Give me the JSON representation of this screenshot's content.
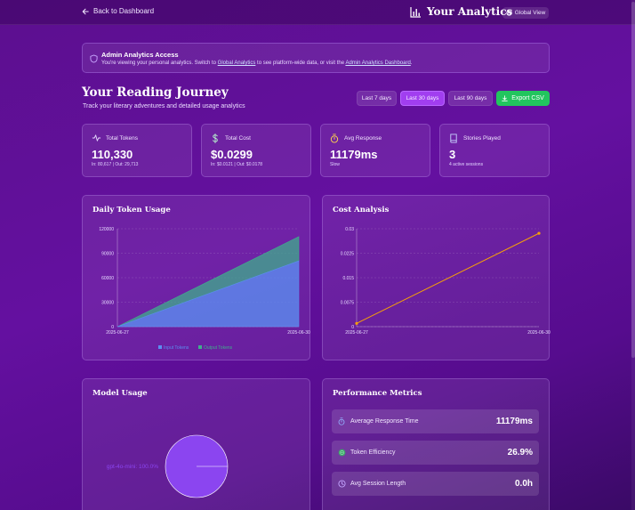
{
  "header": {
    "back_label": "Back to Dashboard",
    "title": "Your Analytics",
    "global_view_label": "Global View"
  },
  "notice": {
    "title": "Admin Analytics Access",
    "text_before": "You're viewing your personal analytics. Switch to ",
    "link1": "Global Analytics",
    "text_middle": " to see platform-wide data, or visit the ",
    "link2": "Admin Analytics Dashboard",
    "text_after": "."
  },
  "page": {
    "title": "Your Reading Journey",
    "subtitle": "Track your literary adventures and detailed usage analytics"
  },
  "ranges": [
    {
      "label": "Last 7 days",
      "active": false
    },
    {
      "label": "Last 30 days",
      "active": true
    },
    {
      "label": "Last 90 days",
      "active": false
    }
  ],
  "export_label": "Export CSV",
  "stats": [
    {
      "icon": "activity-icon",
      "label": "Total Tokens",
      "value": "110,330",
      "sub": "In: 80,617 | Out: 29,713"
    },
    {
      "icon": "dollar-icon",
      "label": "Total Cost",
      "value": "$0.0299",
      "sub": "In: $0.0121 | Out: $0.0178"
    },
    {
      "icon": "timer-icon",
      "label": "Avg Response",
      "value": "11179ms",
      "sub": "Slow"
    },
    {
      "icon": "book-icon",
      "label": "Stories Played",
      "value": "3",
      "sub": "4 active sessions"
    }
  ],
  "colors": {
    "input_tokens": "#5b8df0",
    "output_tokens": "#3fae8c",
    "cost_line": "#f59e0b",
    "pie": "#8b45f0",
    "accent": "#a13ef0",
    "export": "#22c55e"
  },
  "token_panel": {
    "title": "Daily Token Usage"
  },
  "cost_panel": {
    "title": "Cost Analysis"
  },
  "model_panel": {
    "title": "Model Usage"
  },
  "performance_panel": {
    "title": "Performance Metrics",
    "rows": [
      {
        "icon": "timer-icon",
        "label": "Average Response Time",
        "value": "11179ms"
      },
      {
        "icon": "target-icon",
        "label": "Token Efficiency",
        "value": "26.9%"
      },
      {
        "icon": "clock-icon",
        "label": "Avg Session Length",
        "value": "0.0h"
      }
    ]
  },
  "chart_data": [
    {
      "type": "area",
      "title": "Daily Token Usage",
      "x": [
        "2025-06-27",
        "2025-06-30"
      ],
      "series": [
        {
          "name": "Input Tokens",
          "values": [
            0,
            80617
          ]
        },
        {
          "name": "Output Tokens",
          "values": [
            0,
            29713
          ]
        }
      ],
      "stacked": true,
      "yticks": [
        0,
        30000,
        60000,
        90000,
        120000
      ],
      "ylim": [
        0,
        120000
      ],
      "grid": true,
      "legend": "bottom"
    },
    {
      "type": "line",
      "title": "Cost Analysis",
      "x": [
        "2025-06-27",
        "2025-06-30"
      ],
      "series": [
        {
          "values": [
            0.001,
            0.0286
          ]
        }
      ],
      "yticks": [
        0,
        0.0075,
        0.015,
        0.0225,
        0.03
      ],
      "ytick_labels": [
        "0",
        "0.0075",
        "0.015",
        "0.0225",
        "0.03"
      ],
      "ylim": [
        0,
        0.03
      ],
      "grid": true
    },
    {
      "type": "pie",
      "title": "Model Usage",
      "slices": [
        {
          "name": "gpt-4o-mini",
          "value": 100.0,
          "label": "gpt-4o-mini: 100.0%"
        }
      ]
    }
  ]
}
